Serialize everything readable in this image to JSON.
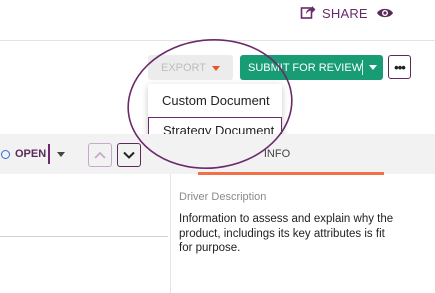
{
  "header": {
    "share_label": "SHARE",
    "share_icon": "share-icon",
    "view_icon": "eye-icon"
  },
  "toolbar": {
    "export_label": "EXPORT",
    "submit_label": "SUBMIT FOR REVIEW",
    "more_label": "•••"
  },
  "export_menu": {
    "items": [
      {
        "label": "Custom Document"
      },
      {
        "label": "Strategy Document"
      }
    ]
  },
  "record_toolbar": {
    "status_label": "OPEN"
  },
  "tabs": {
    "info_label": "INFO"
  },
  "details": {
    "driver_description_label": "Driver Description",
    "driver_description_value": "Information to assess and explain why the product, includings its key attributes is fit for purpose."
  },
  "colors": {
    "brand_purple": "#6b2a6b",
    "submit_green": "#179c73",
    "export_caret": "#e2572b",
    "tab_underline": "#f0704a"
  }
}
